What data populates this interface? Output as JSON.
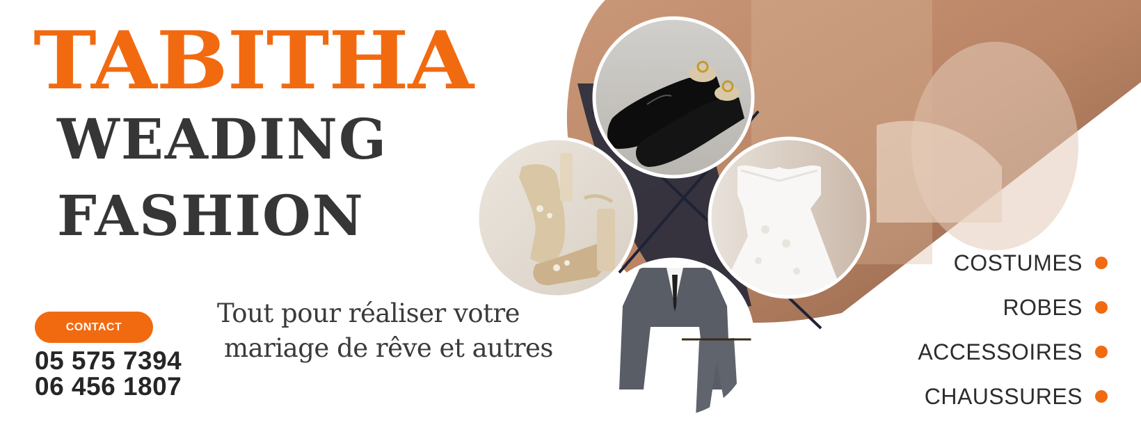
{
  "brand": {
    "name": "TABITHA",
    "line2": "WEADING",
    "line3": "FASHION"
  },
  "contact": {
    "button_label": "CONTACT",
    "phone1": "05 575 7394",
    "phone2": "06 456 1807"
  },
  "tagline": {
    "line1": "Tout pour réaliser votre",
    "line2": "mariage de rêve et autres"
  },
  "services": [
    {
      "label": "COSTUMES"
    },
    {
      "label": "ROBES"
    },
    {
      "label": "ACCESSOIRES"
    },
    {
      "label": "CHAUSSURES"
    }
  ],
  "photos": [
    {
      "subject": "black-dress-shoes"
    },
    {
      "subject": "gold-heeled-sandals"
    },
    {
      "subject": "white-wedding-dress"
    },
    {
      "subject": "grey-three-piece-suit"
    }
  ],
  "colors": {
    "accent": "#f26a10",
    "dark_text": "#363636",
    "background": "#ffffff"
  }
}
